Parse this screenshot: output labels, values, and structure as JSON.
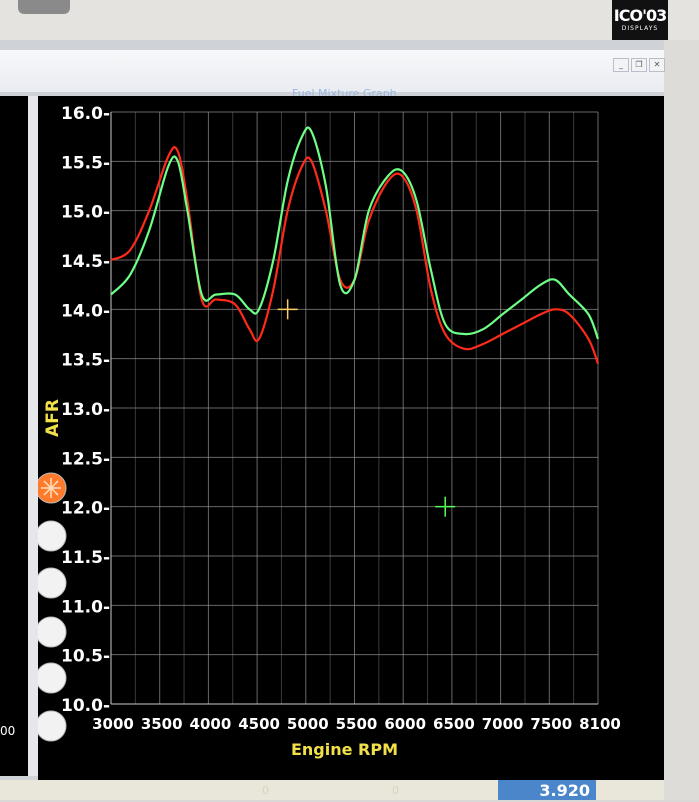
{
  "window": {
    "title": "Fuel Mixture Graph",
    "buttons": [
      "_",
      "❐",
      "✕"
    ]
  },
  "badge": {
    "line1": "ICO'03",
    "line2": "DISPLAYS"
  },
  "left_panel": {
    "partial_label": "00"
  },
  "readout": {
    "value": "3.920"
  },
  "faded_labels": [
    "0",
    "0"
  ],
  "colors": {
    "red": "#ff2a1a",
    "green": "#6dff86",
    "cursor_orange": "#ffcf66",
    "cursor_green": "#55ff55",
    "axis_label": "#f2e04a"
  },
  "chart_data": {
    "type": "line",
    "xlabel": "Engine RPM",
    "ylabel": "AFR",
    "xlim": [
      3000,
      8100
    ],
    "ylim": [
      10.0,
      16.0
    ],
    "x_ticks": [
      "3000",
      "3500",
      "4000",
      "4500",
      "5000",
      "5500",
      "6000",
      "6500",
      "7000",
      "7500",
      "8100"
    ],
    "y_ticks": [
      "16.0-",
      "15.5-",
      "15.0-",
      "14.5-",
      "14.0-",
      "13.5-",
      "13.0-",
      "12.5-",
      "12.0-",
      "11.5-",
      "11.0-",
      "10.5-",
      "10.0-"
    ],
    "grid": true,
    "series": [
      {
        "color": "#ff2a1a",
        "x": [
          3000,
          3200,
          3400,
          3600,
          3700,
          3800,
          3950,
          4100,
          4300,
          4450,
          4550,
          4700,
          4850,
          5000,
          5100,
          5250,
          5400,
          5550,
          5700,
          5900,
          6050,
          6200,
          6350,
          6500,
          6700,
          6900,
          7100,
          7300,
          7500,
          7650,
          7800,
          8000,
          8100
        ],
        "y": [
          14.5,
          14.6,
          15.0,
          15.55,
          15.6,
          15.1,
          14.1,
          14.1,
          14.05,
          13.8,
          13.7,
          14.2,
          15.0,
          15.45,
          15.5,
          15.0,
          14.3,
          14.3,
          14.9,
          15.3,
          15.35,
          15.0,
          14.2,
          13.75,
          13.6,
          13.65,
          13.75,
          13.85,
          13.95,
          14.0,
          13.95,
          13.7,
          13.45
        ]
      },
      {
        "color": "#6dff86",
        "x": [
          3000,
          3200,
          3400,
          3600,
          3700,
          3800,
          3950,
          4100,
          4300,
          4450,
          4550,
          4700,
          4850,
          5000,
          5100,
          5250,
          5400,
          5550,
          5700,
          5900,
          6050,
          6200,
          6350,
          6500,
          6700,
          6900,
          7100,
          7300,
          7500,
          7650,
          7800,
          8000,
          8100
        ],
        "y": [
          14.15,
          14.35,
          14.8,
          15.45,
          15.5,
          15.0,
          14.15,
          14.15,
          14.15,
          14.0,
          14.0,
          14.5,
          15.3,
          15.75,
          15.8,
          15.25,
          14.25,
          14.3,
          15.0,
          15.35,
          15.4,
          15.1,
          14.4,
          13.85,
          13.75,
          13.8,
          13.95,
          14.1,
          14.25,
          14.3,
          14.15,
          13.95,
          13.7
        ]
      }
    ],
    "cursors": [
      {
        "x": 4850,
        "y": 14.0,
        "color": "#ffcf66"
      },
      {
        "x": 6500,
        "y": 12.0,
        "color": "#55ff55"
      }
    ]
  }
}
